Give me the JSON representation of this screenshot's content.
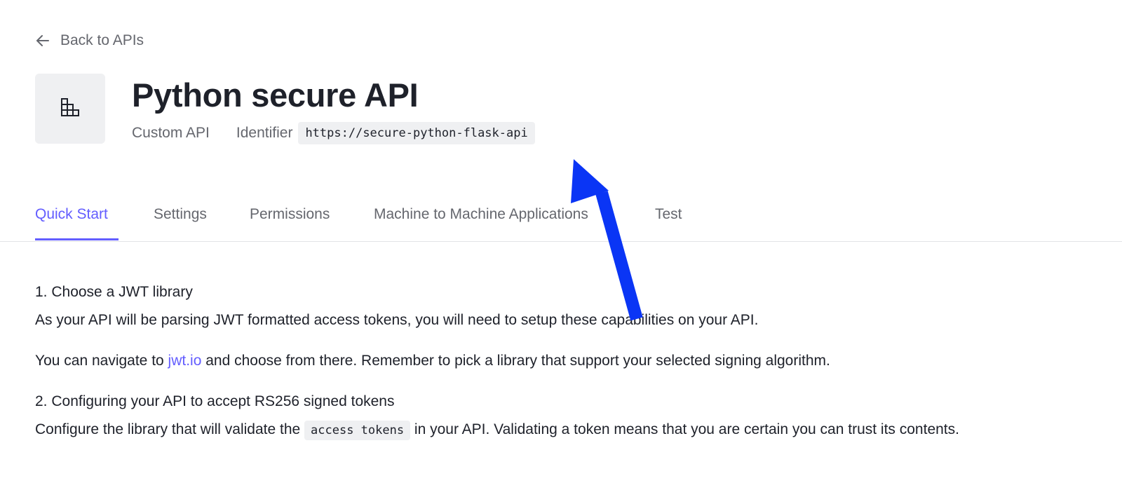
{
  "nav": {
    "back_label": "Back to APIs"
  },
  "header": {
    "title": "Python secure API",
    "type": "Custom API",
    "identifier_label": "Identifier",
    "identifier_value": "https://secure-python-flask-api"
  },
  "tabs": [
    {
      "label": "Quick Start",
      "active": true
    },
    {
      "label": "Settings",
      "active": false
    },
    {
      "label": "Permissions",
      "active": false
    },
    {
      "label": "Machine to Machine Applications",
      "active": false
    },
    {
      "label": "Test",
      "active": false
    }
  ],
  "content": {
    "step1_heading": "1. Choose a JWT library",
    "step1_para1": "As your API will be parsing JWT formatted access tokens, you will need to setup these capabilities on your API.",
    "step1_para2_before": "You can navigate to ",
    "step1_para2_link": "jwt.io",
    "step1_para2_after": " and choose from there. Remember to pick a library that support your selected signing algorithm.",
    "step2_heading": "2. Configuring your API to accept RS256 signed tokens",
    "step2_para_before": "Configure the library that will validate the ",
    "step2_para_code": "access tokens",
    "step2_para_after": " in your API. Validating a token means that you are certain you can trust its contents."
  },
  "colors": {
    "accent": "#635dff",
    "annotation_arrow": "#0a35f5",
    "text_primary": "#1e212a",
    "text_secondary": "#65676e",
    "code_background": "#eff0f2"
  },
  "icons": {
    "back": "arrow-left-icon",
    "api": "api-blocks-icon"
  }
}
